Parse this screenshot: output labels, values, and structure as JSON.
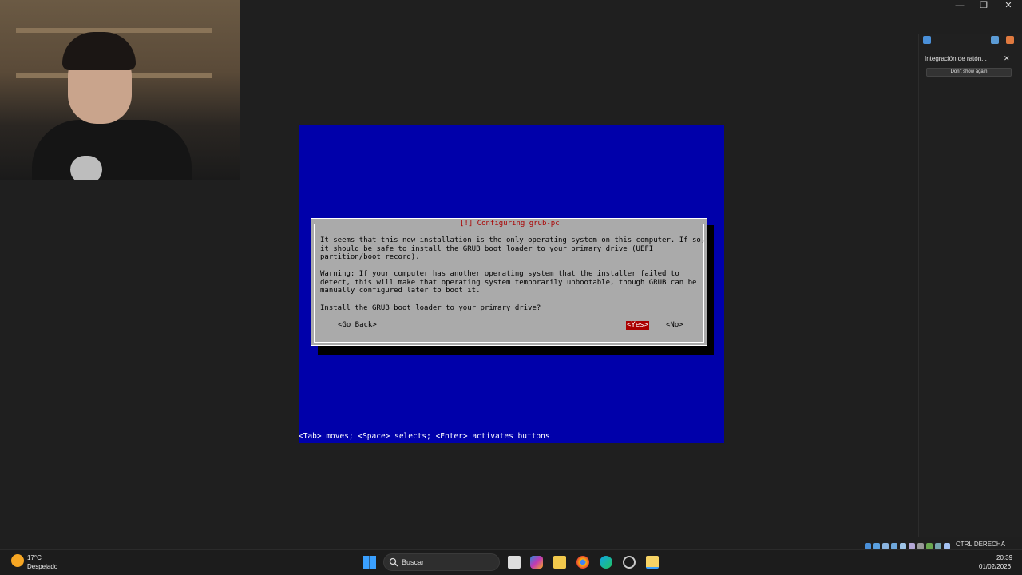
{
  "window": {
    "minimize": "—",
    "restore": "❐",
    "close": "✕"
  },
  "installer": {
    "dialog_title": "[!] Configuring grub-pc",
    "paragraph1": "It seems that this new installation is the only operating system on this computer. If so,\nit should be safe to install the GRUB boot loader to your primary drive (UEFI\npartition/boot record).",
    "paragraph2": "Warning: If your computer has another operating system that the installer failed to\ndetect, this will make that operating system temporarily unbootable, though GRUB can be\nmanually configured later to boot it.",
    "question": "Install the GRUB boot loader to your primary drive?",
    "go_back": "<Go Back>",
    "yes": "<Yes>",
    "no": "<No>",
    "hint": "<Tab> moves; <Space> selects; <Enter> activates buttons",
    "colors": {
      "background": "#0000aa",
      "dialog": "#aaaaaa",
      "accent": "#aa0000"
    }
  },
  "notification": {
    "title": "Integración de ratón...",
    "close": "✕",
    "button": "Don't show again"
  },
  "vbox_status": {
    "host_key": "CTRL DERECHA"
  },
  "taskbar": {
    "weather_temp": "17°C",
    "weather_desc": "Despejado",
    "search_placeholder": "Buscar",
    "time": "20:39",
    "date": "01/02/2026"
  }
}
